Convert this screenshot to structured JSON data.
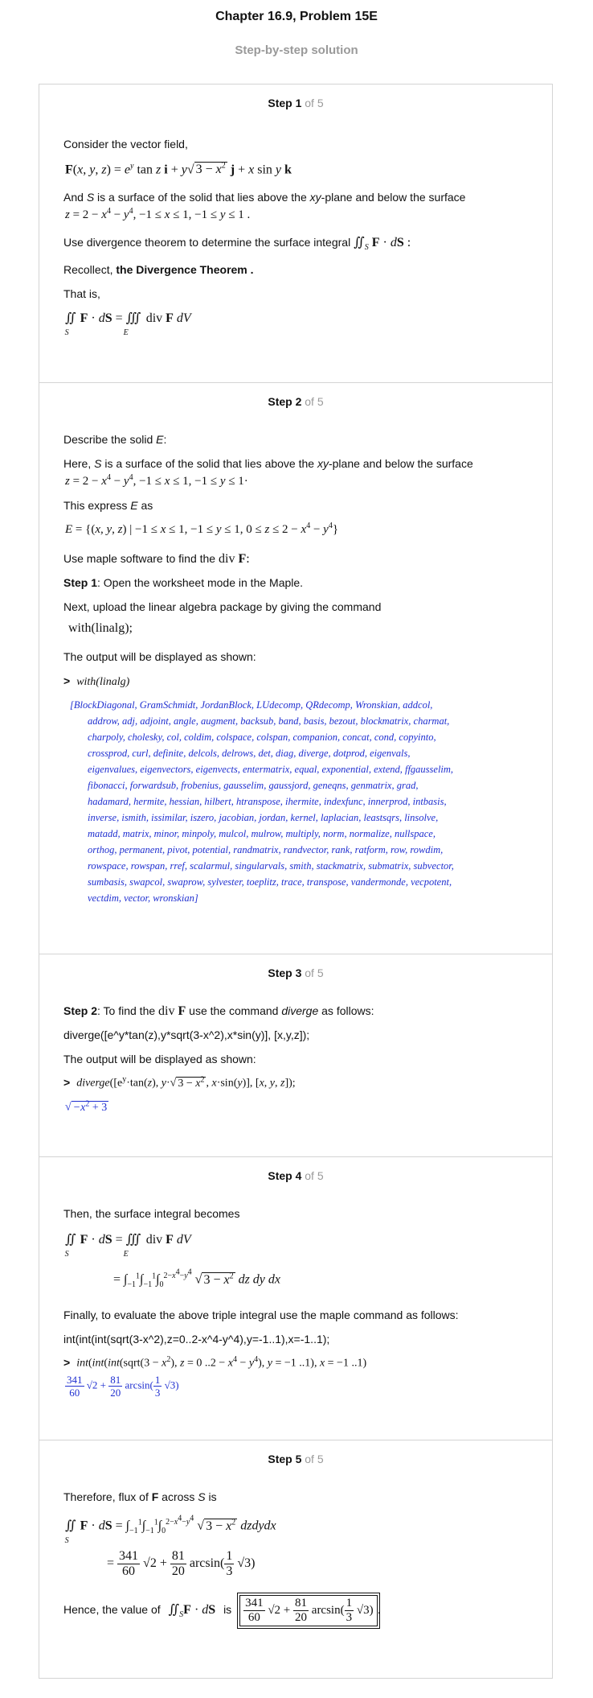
{
  "header": {
    "title": "Chapter 16.9, Problem 15E",
    "subtitle": "Step-by-step solution"
  },
  "steps": [
    {
      "label": "Step 1",
      "of": "of 5",
      "consider": "Consider the vector field,",
      "field": "F(x, y, z) = e^y tan z i + y√(3 − x²) j + x sin y k",
      "and_s_1": "And ",
      "and_s_S": "S",
      "and_s_2": " is a surface of the solid that lies above the ",
      "and_s_xy": "xy",
      "and_s_3": "-plane and below the surface",
      "surface": "z = 2 − x⁴ − y⁴, −1 ≤ x ≤ 1, −1 ≤ y ≤ 1 .",
      "use_div": "Use divergence theorem to determine the surface integral",
      "use_div_integral": "∬S F · dS :",
      "recollect_1": "Recollect, ",
      "recollect_bold": "the Divergence Theorem .",
      "that_is": "That is,",
      "theorem": "∬S F · dS = ∭E div F dV"
    },
    {
      "label": "Step 2",
      "of": "of 5",
      "describe_1": "Describe the solid ",
      "describe_E": "E",
      "describe_2": ":",
      "here_1": "Here, ",
      "here_S": "S",
      "here_2": " is a surface of the solid that lies above the ",
      "here_xy": "xy",
      "here_3": "-plane and below the surface",
      "surface": "z = 2 − x⁴ − y⁴, −1 ≤ x ≤ 1, −1 ≤ y ≤ 1·",
      "express_1": "This express ",
      "express_E": "E",
      "express_2": " as",
      "set": "E = {(x, y, z) | −1 ≤ x ≤ 1, −1 ≤ y ≤ 1, 0 ≤ z ≤ 2 − x⁴ − y⁴}",
      "use_maple": "Use maple software to find the",
      "use_maple_math": "div F:",
      "step1_bold": "Step 1",
      "step1_text": ": Open the worksheet mode in the Maple.",
      "next_upload": "Next, upload the linear algebra package by giving the command",
      "with_cmd": "with(linalg);",
      "output_shown": "The output will be displayed as shown:",
      "prompt_cmd": "with(linalg)",
      "maple_lines": [
        "[BlockDiagonal, GramSchmidt, JordanBlock, LUdecomp, QRdecomp, Wronskian, addcol,",
        "addrow, adj, adjoint, angle, augment, backsub, band, basis, bezout, blockmatrix, charmat,",
        "charpoly, cholesky, col, coldim, colspace, colspan, companion, concat, cond, copyinto,",
        "crossprod, curl, definite, delcols, delrows, det, diag, diverge, dotprod, eigenvals,",
        "eigenvalues, eigenvectors, eigenvects, entermatrix, equal, exponential, extend, ffgausselim,",
        "fibonacci, forwardsub, frobenius, gausselim, gaussjord, geneqns, genmatrix, grad,",
        "hadamard, hermite, hessian, hilbert, htranspose, ihermite, indexfunc, innerprod, intbasis,",
        "inverse, ismith, issimilar, iszero, jacobian, jordan, kernel, laplacian, leastsqrs, linsolve,",
        "matadd, matrix, minor, minpoly, mulcol, mulrow, multiply, norm, normalize, nullspace,",
        "orthog, permanent, pivot, potential, randmatrix, randvector, rank, ratform, row, rowdim,",
        "rowspace, rowspan, rref, scalarmul, singularvals, smith, stackmatrix, submatrix, subvector,",
        "sumbasis, swapcol, swaprow, sylvester, toeplitz, trace, transpose, vandermonde, vecpotent,",
        "vectdim, vector, wronskian]"
      ]
    },
    {
      "label": "Step 3",
      "of": "of 5",
      "step2_bold": "Step 2",
      "step2_text_1": ": To find the ",
      "step2_math": "div F",
      "step2_text_2": " use the command ",
      "step2_italic": "diverge",
      "step2_text_3": " as follows:",
      "command": "diverge([e^y*tan(z),y*sqrt(3-x^2),x*sin(y)], [x,y,z]);",
      "output_shown": "The output will be displayed as shown:",
      "prompt_cmd": "diverge([e^y·tan(z), y·√(3 − x²), x·sin(y)], [x, y, z]);",
      "result": "√(−x² + 3)"
    },
    {
      "label": "Step 4",
      "of": "of 5",
      "then": "Then, the surface integral becomes",
      "line1": "∬S F · dS = ∭E div F dV",
      "line2": "= ∫₋₁¹ ∫₋₁¹ ∫₀^(2−x⁴−y⁴) √(3 − x²) dz dy dx",
      "finally": "Finally, to evaluate the above triple integral use the maple command as follows:",
      "command": "int(int(int(sqrt(3-x^2),z=0..2-x^4-y^4),y=-1..1),x=-1..1);",
      "prompt_cmd": "int(int(int(sqrt(3 − x²), z = 0 ..2 − x⁴ − y⁴), y = −1 ..1), x = −1 ..1)",
      "result": "341/60 √2 + 81/20 arcsin(1/3 √3)"
    },
    {
      "label": "Step 5",
      "of": "of 5",
      "therefore_1": "Therefore, flux of ",
      "therefore_F": "F",
      "therefore_2": " across ",
      "therefore_S": "S",
      "therefore_3": " is",
      "line1": "∬S F · dS = ∫₋₁¹ ∫₋₁¹ ∫₀^(2−x⁴−y⁴) √(3 − x²) dzdydx",
      "line2": "= 341/60 √2 + 81/20 arcsin(1/3 √3)",
      "hence_1": "Hence, the value of",
      "hence_integral": "∬S F · dS",
      "hence_2": "is",
      "answer": "341/60 √2 + 81/20 arcsin(1/3 √3)."
    }
  ]
}
